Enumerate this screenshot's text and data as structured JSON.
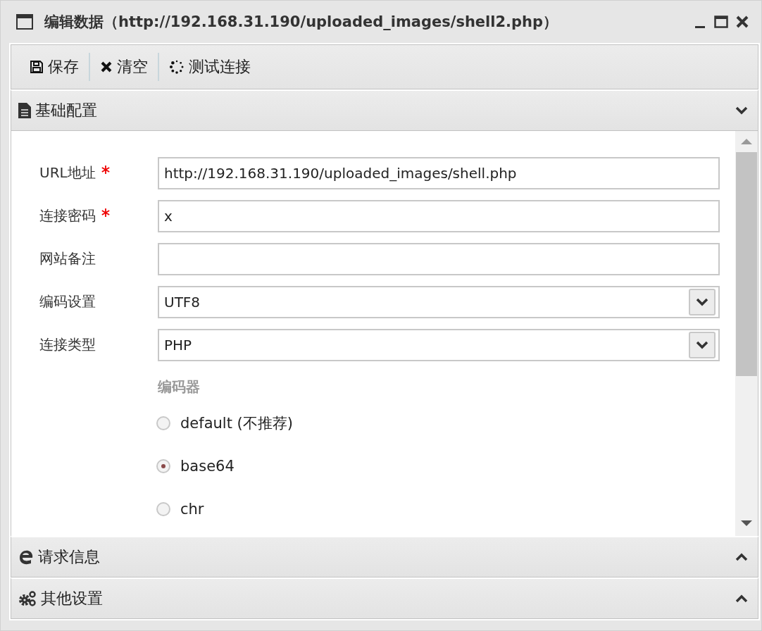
{
  "window": {
    "title": "编辑数据（http://192.168.31.190/uploaded_images/shell2.php）"
  },
  "toolbar": [
    {
      "kind": "save",
      "label": "保存"
    },
    {
      "kind": "clear",
      "label": "清空"
    },
    {
      "kind": "test",
      "label": "测试连接"
    }
  ],
  "sections": [
    {
      "kind": "basic",
      "title": "基础配置",
      "expanded": true,
      "fields": [
        {
          "kind": "text",
          "label": "URL地址",
          "required": true,
          "value": "http://192.168.31.190/uploaded_images/shell.php"
        },
        {
          "kind": "text",
          "label": "连接密码",
          "required": true,
          "value": "x"
        },
        {
          "kind": "text",
          "label": "网站备注",
          "required": false
        },
        {
          "kind": "select",
          "label": "编码设置",
          "required": false,
          "value": "UTF8"
        },
        {
          "kind": "select",
          "label": "连接类型",
          "required": false,
          "value": "PHP"
        }
      ],
      "encoder": {
        "title": "编码器",
        "options": [
          {
            "label": "default (不推荐)",
            "selected": false
          },
          {
            "label": "base64",
            "selected": true
          },
          {
            "label": "chr",
            "selected": false
          }
        ]
      }
    },
    {
      "kind": "request",
      "title": "请求信息",
      "expanded": false
    },
    {
      "kind": "other",
      "title": "其他设置",
      "expanded": false
    }
  ]
}
